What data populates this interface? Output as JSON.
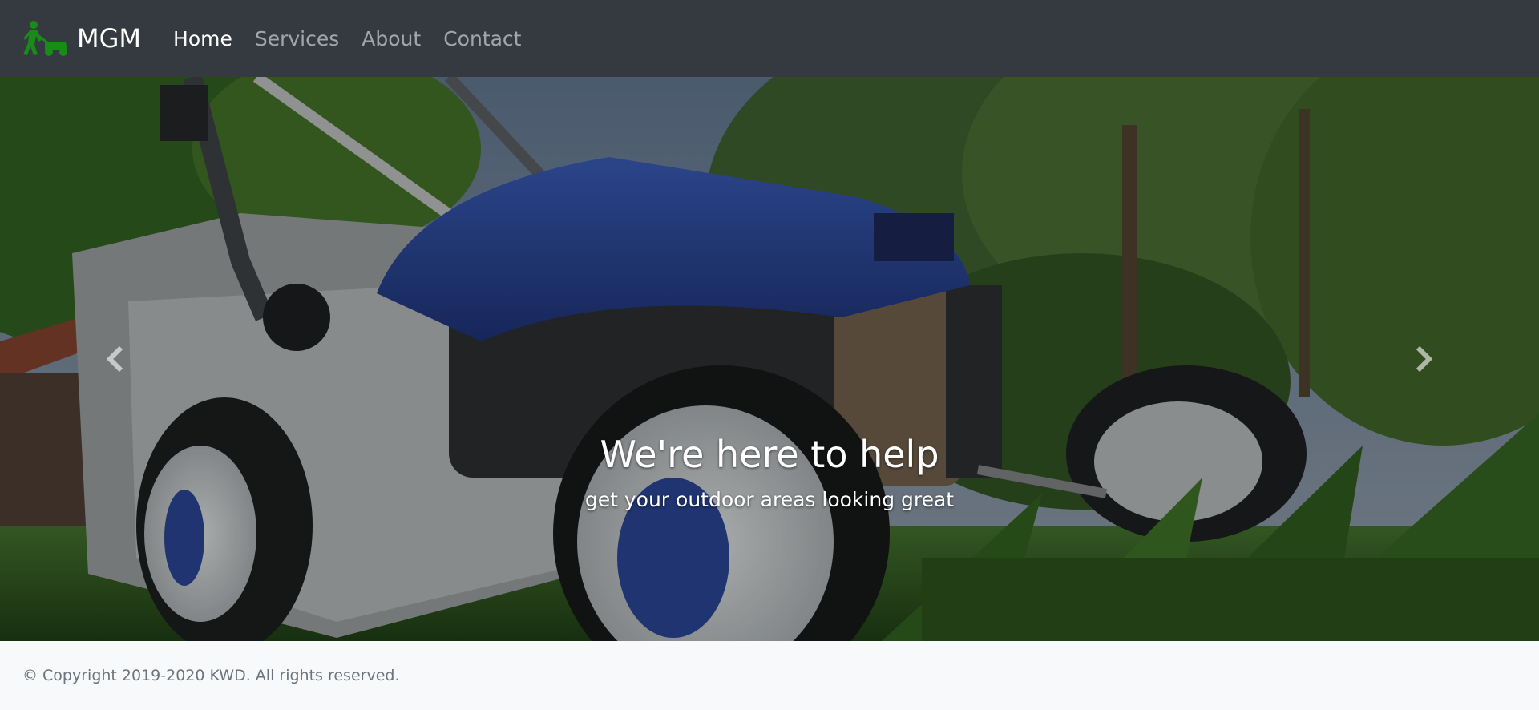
{
  "brand": {
    "name": "MGM",
    "logo_icon": "lawn-mower-person-icon",
    "logo_color": "#1a8a1a"
  },
  "nav": {
    "items": [
      {
        "label": "Home",
        "active": true
      },
      {
        "label": "Services",
        "active": false
      },
      {
        "label": "About",
        "active": false
      },
      {
        "label": "Contact",
        "active": false
      }
    ]
  },
  "carousel": {
    "image_subject": "lawn-mower-photo",
    "caption_title": "We're here to help",
    "caption_subtitle": "get your outdoor areas looking great",
    "prev_icon": "chevron-left-icon",
    "next_icon": "chevron-right-icon"
  },
  "footer": {
    "text": "© Copyright 2019-2020 KWD. All rights reserved."
  },
  "colors": {
    "navbar_bg": "#343a40",
    "footer_bg": "#f8f9fa",
    "nav_inactive": "#9a9da0",
    "nav_active": "#ffffff"
  }
}
